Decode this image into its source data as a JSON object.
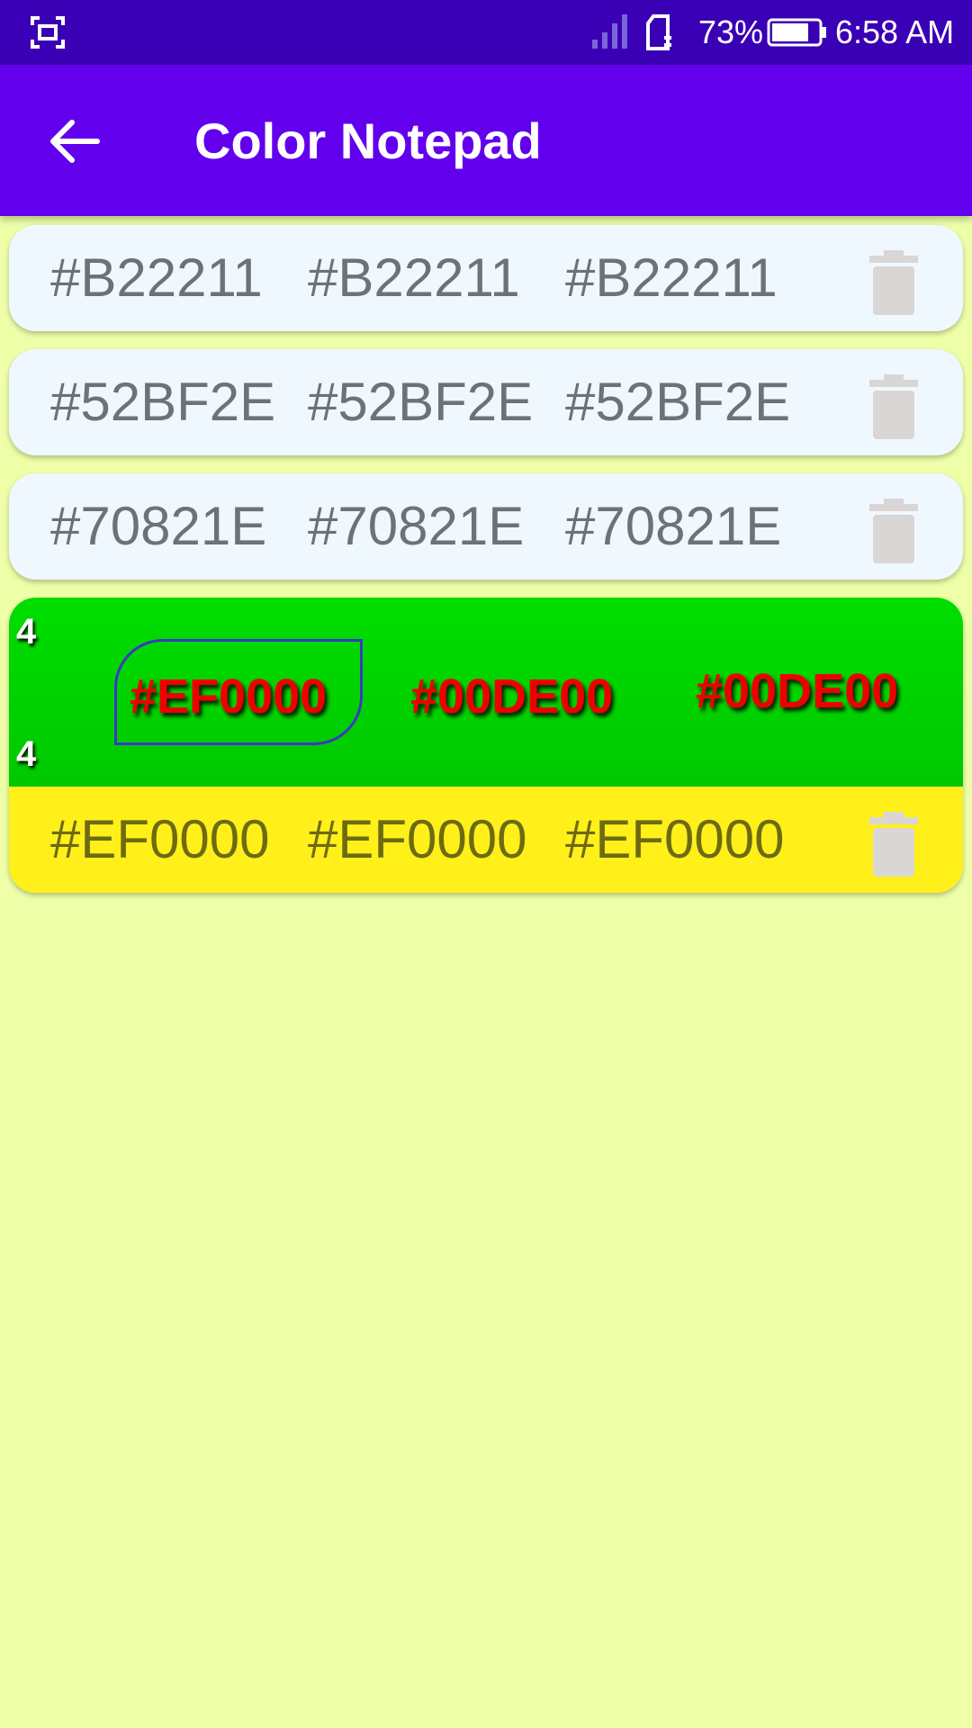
{
  "status_bar": {
    "battery_percent": "73%",
    "time": "6:58 AM",
    "icons": [
      "screenshot-icon",
      "signal-icon",
      "sim-icon",
      "battery-icon"
    ]
  },
  "app_bar": {
    "title": "Color Notepad",
    "back_icon": "arrow-left-icon"
  },
  "cards": [
    {
      "colors": [
        "#B22211",
        "#B22211",
        "#B22211"
      ],
      "delete_icon": "trash-icon"
    },
    {
      "colors": [
        "#52BF2E",
        "#52BF2E",
        "#52BF2E"
      ],
      "delete_icon": "trash-icon"
    },
    {
      "colors": [
        "#70821E",
        "#70821E",
        "#70821E"
      ],
      "delete_icon": "trash-icon"
    }
  ],
  "expanded_card": {
    "count_top": "4",
    "count_bottom": "4",
    "preview_colors": [
      "#EF0000",
      "#00DE00",
      "#00DE00"
    ],
    "row_colors": [
      "#EF0000",
      "#EF0000",
      "#EF0000"
    ],
    "delete_icon": "trash-icon",
    "panel_background": "#00DE00",
    "row_background": "#FFF01A",
    "text_color": "#EF0000"
  },
  "theme": {
    "status_bar_color": "#3A00B5",
    "app_bar_color": "#6200EE",
    "page_background": "#EEFFA8",
    "card_background": "#F0F8FF"
  }
}
